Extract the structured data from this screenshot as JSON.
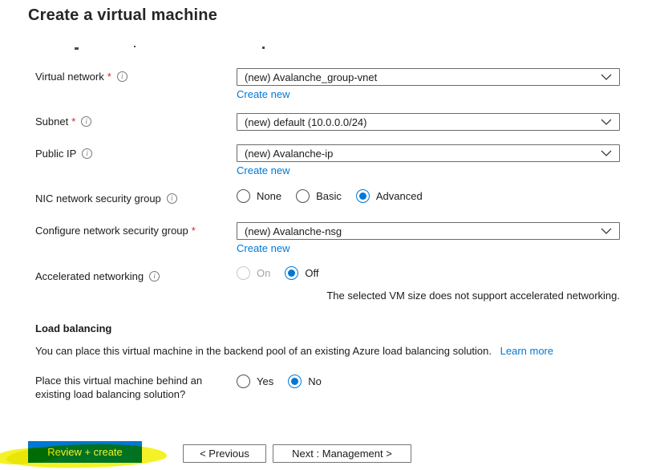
{
  "page": {
    "title": "Create a virtual machine"
  },
  "colors": {
    "accent": "#0078d4",
    "link": "#0078d4",
    "required_asterisk": "#bc2f32",
    "primary_button_bg": "#0078d4",
    "primary_button_text": "#ffffff",
    "highlight_annotation": "#f4f227"
  },
  "form": {
    "required_marker": "*",
    "rows": [
      {
        "label": "Virtual network",
        "required": true,
        "control": "dropdown",
        "value": "(new) Avalanche_group-vnet",
        "create_new": "Create new"
      },
      {
        "label": "Subnet",
        "required": true,
        "control": "dropdown",
        "value": "(new) default (10.0.0.0/24)"
      },
      {
        "label": "Public IP",
        "control": "dropdown",
        "value": "(new) Avalanche-ip",
        "create_new": "Create new"
      },
      {
        "label": "NIC network security group",
        "control": "radio",
        "options": [
          "None",
          "Basic",
          "Advanced"
        ],
        "selected": "Advanced"
      },
      {
        "label": "Configure network security group",
        "required": true,
        "control": "dropdown",
        "value": "(new) Avalanche-nsg",
        "create_new": "Create new"
      },
      {
        "label": "Accelerated networking",
        "control": "radio",
        "options": [
          "On",
          "Off"
        ],
        "selected": "Off",
        "disabled_options": [
          "On"
        ],
        "note": "The selected VM size does not support accelerated networking."
      }
    ]
  },
  "load_balancing": {
    "header": "Load balancing",
    "description": "You can place this virtual machine in the backend pool of an existing Azure load balancing solution.",
    "learn_more": "Learn more",
    "question": "Place this virtual machine behind an existing load balancing solution?",
    "options": [
      "Yes",
      "No"
    ],
    "selected": "No"
  },
  "footer": {
    "review_create": "Review + create",
    "previous": "< Previous",
    "next": "Next : Management >"
  }
}
